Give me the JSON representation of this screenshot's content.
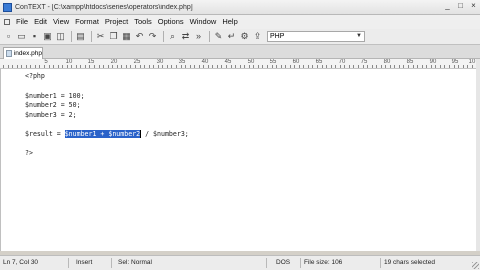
{
  "window": {
    "title": "ConTEXT - [C:\\xampp\\htdocs\\series\\operators\\index.php]",
    "controls": [
      "_",
      "□",
      "×"
    ]
  },
  "menu": [
    "File",
    "Edit",
    "View",
    "Format",
    "Project",
    "Tools",
    "Options",
    "Window",
    "Help"
  ],
  "toolbar": {
    "icons": [
      "new-file-icon",
      "open-folder-icon",
      "save-icon",
      "save-all-icon",
      "close-file-icon",
      "print-icon",
      "cut-icon",
      "copy-icon",
      "paste-icon",
      "undo-icon",
      "redo-icon",
      "find-icon",
      "replace-icon",
      "search-next-icon",
      "highlighter-icon",
      "wrap-icon",
      "settings-icon",
      "export-icon"
    ],
    "syntax_value": "PHP"
  },
  "tab": {
    "label": "index.php"
  },
  "ruler": [
    "5",
    "10",
    "15",
    "20",
    "25",
    "30",
    "35",
    "40",
    "45",
    "50",
    "55",
    "60",
    "65",
    "70",
    "75",
    "80",
    "85",
    "90",
    "95",
    "10"
  ],
  "code": {
    "l1": "<?php",
    "l3": "$number1 = 100;",
    "l4": "$number2 = 50;",
    "l5": "$number3 = 2;",
    "l7_pre": "$result = ",
    "l7_sel": "$number1 + $number2",
    "l7_post": " / $number3;",
    "l9": "?>"
  },
  "status": {
    "position": "Ln 7, Col 30",
    "mode": "Insert",
    "selection": "Sel: Normal",
    "format": "DOS",
    "filesize": "File size: 106",
    "selected": "19 chars selected"
  }
}
